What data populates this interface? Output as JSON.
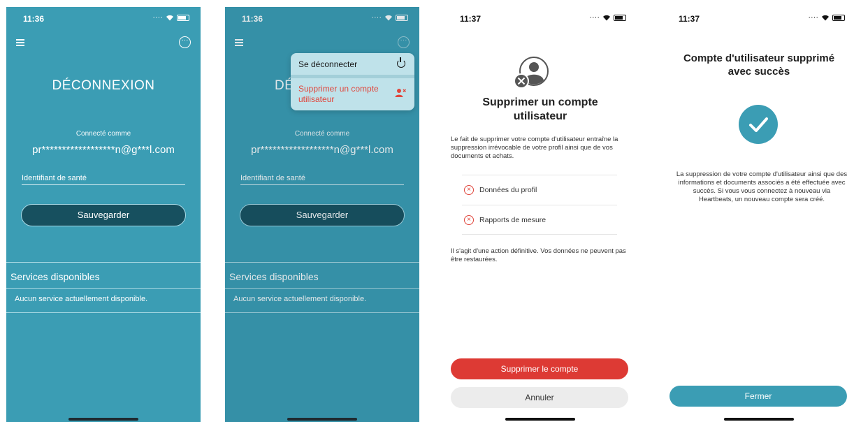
{
  "screen1": {
    "time": "11:36",
    "title": "DÉCONNEXION",
    "connected_label": "Connecté comme",
    "email": "pr******************n@g***l.com",
    "health_id_placeholder": "Identifiant de santé",
    "save_label": "Sauvegarder",
    "services_title": "Services disponibles",
    "services_empty": "Aucun service actuellement disponible."
  },
  "screen2": {
    "time": "11:36",
    "title_partial": "DÉ",
    "connected_label": "Connecté comme",
    "email": "pr******************n@g***l.com",
    "health_id_placeholder": "Identifiant de santé",
    "save_label": "Sauvegarder",
    "services_title": "Services disponibles",
    "services_empty": "Aucun service actuellement disponible.",
    "menu": {
      "logout_label": "Se déconnecter",
      "delete_label": "Supprimer un compte utilisateur"
    }
  },
  "screen3": {
    "time": "11:37",
    "title": "Supprimer un compte utilisateur",
    "description": "Le fait de supprimer votre compte d'utilisateur entraîne la suppression irrévocable de votre profil ainsi que de vos documents et achats.",
    "items": [
      "Données du profil",
      "Rapports de mesure"
    ],
    "final_note": "Il s'agit d'une action définitive. Vos données ne peuvent pas être restaurées.",
    "delete_button": "Supprimer le compte",
    "cancel_button": "Annuler"
  },
  "screen4": {
    "time": "11:37",
    "title": "Compte d'utilisateur supprimé avec succès",
    "description": "La suppression de votre compte d'utilisateur ainsi que des informations et documents associés a été effectuée avec succès. Si vous vous connectez à nouveau via Heartbeats, un nouveau compte sera créé.",
    "close_button": "Fermer"
  },
  "colors": {
    "teal": "#3b9db4",
    "dark_teal": "#17505f",
    "danger": "#dd3a34"
  },
  "icons": [
    "menu-icon",
    "more-icon",
    "wifi-icon",
    "battery-icon",
    "power-icon",
    "user-remove-icon",
    "user-remove-avatar-icon",
    "x-circle-icon",
    "checkmark-icon"
  ]
}
